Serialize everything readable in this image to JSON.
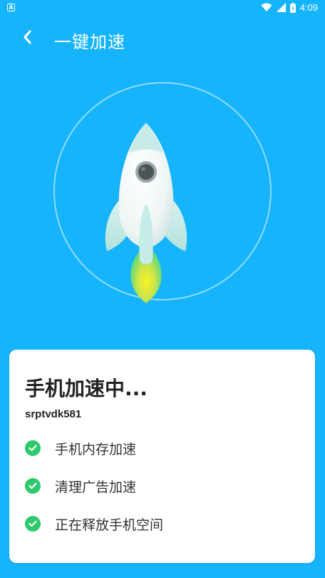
{
  "status_bar": {
    "notification_icon": "a-notification-icon",
    "wifi_icon": "wifi-icon",
    "signal_icon": "signal-icon",
    "battery_icon": "battery-charging-icon",
    "time": "4:09"
  },
  "app_bar": {
    "back_icon": "chevron-left-icon",
    "title": "一键加速"
  },
  "hero": {
    "ring_icon": "progress-ring",
    "rocket_icon": "rocket-icon"
  },
  "card": {
    "title": "手机加速中...",
    "subtitle": "srptvdk581",
    "tasks": [
      {
        "label": "手机内存加速",
        "icon": "check-circle-icon",
        "done": true
      },
      {
        "label": "清理广告加速",
        "icon": "check-circle-icon",
        "done": true
      },
      {
        "label": "正在释放手机空间",
        "icon": "check-circle-icon",
        "done": true
      }
    ]
  },
  "colors": {
    "background": "#16b4fa",
    "card": "#ffffff",
    "check": "#2dc96b",
    "rocket_body": "#f2f7f7",
    "rocket_fin": "#c5ecea",
    "flame_outer": "#3fd38f",
    "flame_inner": "#f4ee2a"
  }
}
